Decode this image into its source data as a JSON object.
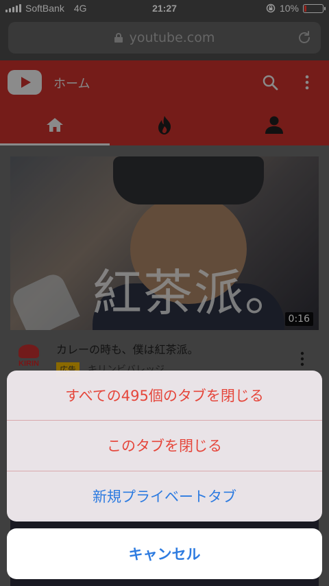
{
  "status_bar": {
    "carrier": "SoftBank",
    "network": "4G",
    "time": "21:27",
    "battery_percent": "10%",
    "battery_level": 0.1
  },
  "browser": {
    "url": "youtube.com"
  },
  "youtube": {
    "header_title": "ホーム",
    "tabs": [
      "home",
      "trending",
      "account"
    ],
    "active_tab": "home",
    "brand_color": "#c4302b"
  },
  "video": {
    "thumbnail_caption": "紅茶派。",
    "duration": "0:16",
    "title": "カレーの時も、僕は紅茶派。",
    "ad_label": "広告",
    "channel": "キリンビバレッジ",
    "channel_logo_text": "KIRIN"
  },
  "action_sheet": {
    "close_all_tabs": "すべての495個のタブを閉じる",
    "close_this_tab": "このタブを閉じる",
    "new_private_tab": "新規プライベートタブ",
    "cancel": "キャンセル",
    "destructive_color": "#e5463b",
    "action_color": "#2d7be0"
  }
}
